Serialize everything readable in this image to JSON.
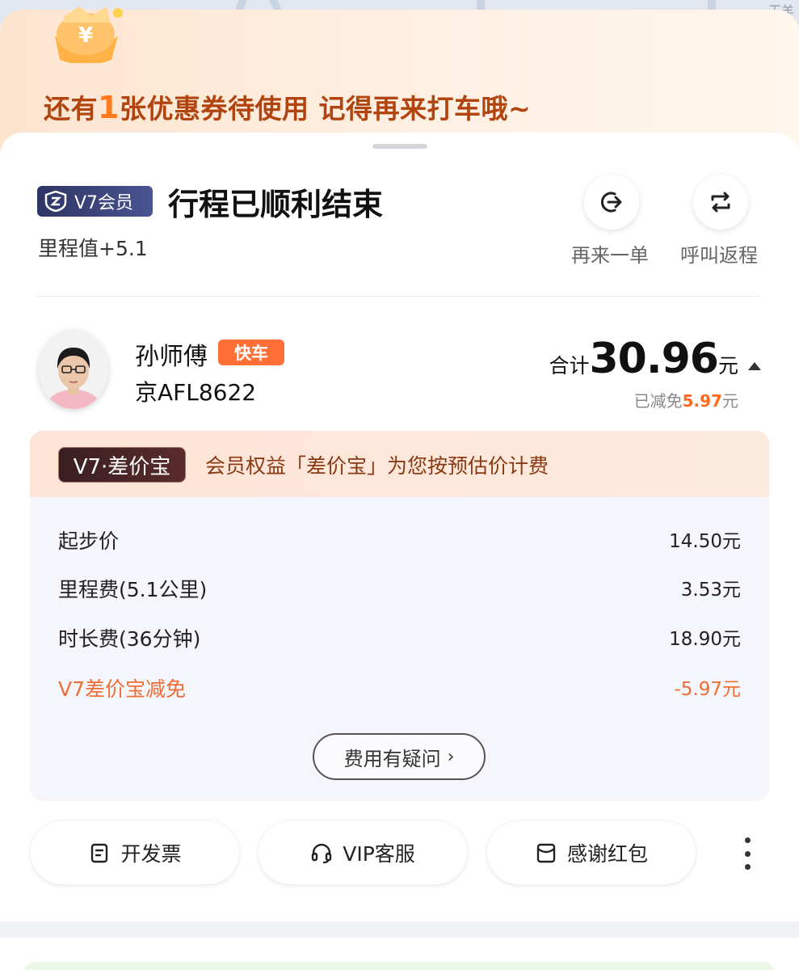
{
  "map": {
    "label": "玉羊"
  },
  "promo": {
    "text_before": "还有",
    "count": "1",
    "text_after": "张优惠券待使用 记得再来打车哦~"
  },
  "header": {
    "vip_label": "V7会员",
    "title": "行程已顺利结束",
    "mileage": "里程值+5.1",
    "actions": [
      {
        "label": "再来一单",
        "icon": "reorder-icon"
      },
      {
        "label": "呼叫返程",
        "icon": "return-trip-icon"
      }
    ]
  },
  "driver": {
    "name": "孙师傅",
    "car_type": "快车",
    "plate": "京AFL8622"
  },
  "total": {
    "prefix": "合计",
    "value": "30.96",
    "unit": "元",
    "saved_prefix": "已减免",
    "saved_amount": "5.97",
    "saved_unit": "元"
  },
  "fee": {
    "tag": "V7·差价宝",
    "banner": "会员权益「差价宝」为您按预估价计费",
    "rows": [
      {
        "label": "起步价",
        "value": "14.50元"
      },
      {
        "label": "里程费(5.1公里)",
        "value": "3.53元"
      },
      {
        "label": "时长费(36分钟)",
        "value": "18.90元"
      },
      {
        "label": "V7差价宝减免",
        "value": "-5.97元"
      }
    ],
    "question_label": "费用有疑问",
    "question_chevron": "›"
  },
  "bottom_actions": [
    {
      "label": "开发票",
      "icon": "invoice-icon"
    },
    {
      "label": "VIP客服",
      "icon": "headset-icon"
    },
    {
      "label": "感谢红包",
      "icon": "red-packet-icon"
    }
  ],
  "colors": {
    "accent_orange": "#ff6f36",
    "promo_text": "#b2440f",
    "discount": "#ef6d36",
    "vip_navy": "#2d3565"
  }
}
